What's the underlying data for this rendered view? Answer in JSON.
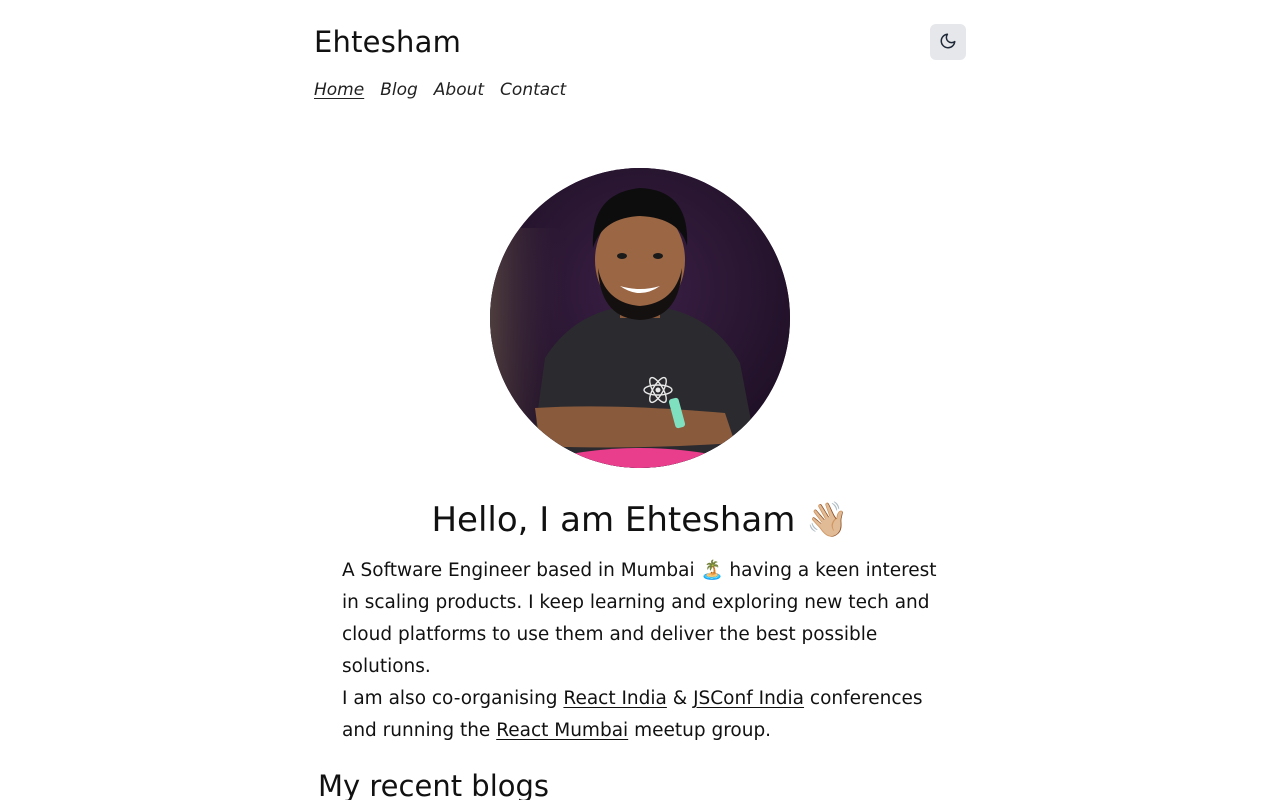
{
  "header": {
    "site_title": "Ehtesham",
    "theme_toggle_icon": "moon-icon"
  },
  "nav": {
    "items": [
      {
        "label": "Home",
        "active": true
      },
      {
        "label": "Blog",
        "active": false
      },
      {
        "label": "About",
        "active": false
      },
      {
        "label": "Contact",
        "active": false
      }
    ]
  },
  "hero": {
    "avatar_icon": "profile-photo",
    "title": "Hello, I am Ehtesham 👋🏼",
    "intro_line1": "A Software Engineer based in Mumbai 🏝️ having a keen interest in scaling products. I keep learning and exploring new tech and cloud platforms to use them and deliver the best possible solutions.",
    "intro_prefix": "I am also co-organising ",
    "link_react_india": "React India",
    "amp": " & ",
    "link_jsconf_india": "JSConf India",
    "intro_middle": " conferences and running the ",
    "link_react_mumbai": "React Mumbai",
    "intro_suffix": " meetup group."
  },
  "sections": {
    "recent_blogs_title": "My recent blogs"
  },
  "colors": {
    "toggle_bg": "#e5e7eb",
    "text": "#111111",
    "background": "#ffffff"
  }
}
